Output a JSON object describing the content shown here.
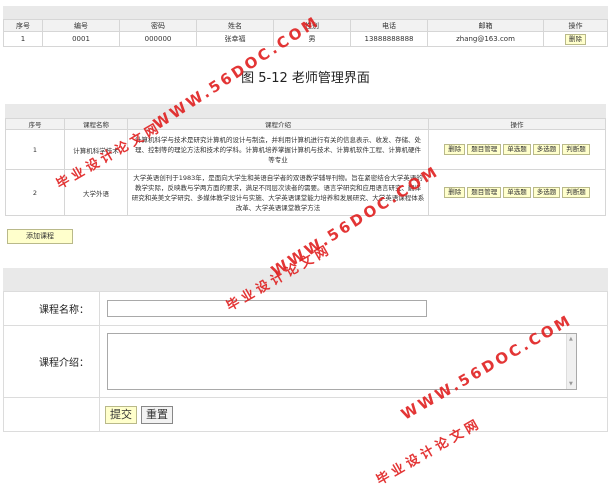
{
  "teacher_table": {
    "headers": [
      "序号",
      "编号",
      "密码",
      "姓名",
      "性别",
      "电话",
      "邮箱",
      "操作"
    ],
    "rows": [
      {
        "no": "1",
        "id": "0001",
        "password": "000000",
        "name": "张幸福",
        "gender": "男",
        "phone": "13888888888",
        "email": "zhang@163.com",
        "delete": "删除"
      }
    ]
  },
  "caption": "图 5-12 老师管理界面",
  "course_table": {
    "headers": [
      "序号",
      "课程名称",
      "课程介绍",
      "操作"
    ],
    "rows": [
      {
        "no": "1",
        "name": "计算机科学技术",
        "desc": [
          "计算机科学与技术是研究计算机的设计与制造，并利用计算机进行有关的信息表示、收发、存储、处",
          "理、控制等的理论方法和技术的学科。计算机培养掌握计算机与技术、计算机软件工程、计算机硬件",
          "等专业"
        ]
      },
      {
        "no": "2",
        "name": "大学外语",
        "desc": [
          "大学英语创刊于1983年，是面向大学生和英语自学者的双语教学辅导刊物。旨在紧密结合大学英语的",
          "教学实际，反映教与学两方面的要求，满足不同层次读者的需要。语言学研究和应用语言研究、翻译",
          "研究和英美文学研究、多媒体教学设计与实施、大学英语课堂能力培养和发展研究、大学英语课程体系",
          "改革、大学英语课堂教学方法"
        ]
      }
    ],
    "actions": [
      "删除",
      "题目管理",
      "单选题",
      "多选题",
      "判断题"
    ]
  },
  "add_course_label": "添加课程",
  "form": {
    "name_label": "课程名称：",
    "desc_label": "课程介绍：",
    "submit_label": "提交",
    "reset_label": "重置"
  },
  "watermark": {
    "site_url": "WWW.56DOC.COM",
    "site_cn": "毕业设计论文网",
    "color": "#e02020"
  }
}
